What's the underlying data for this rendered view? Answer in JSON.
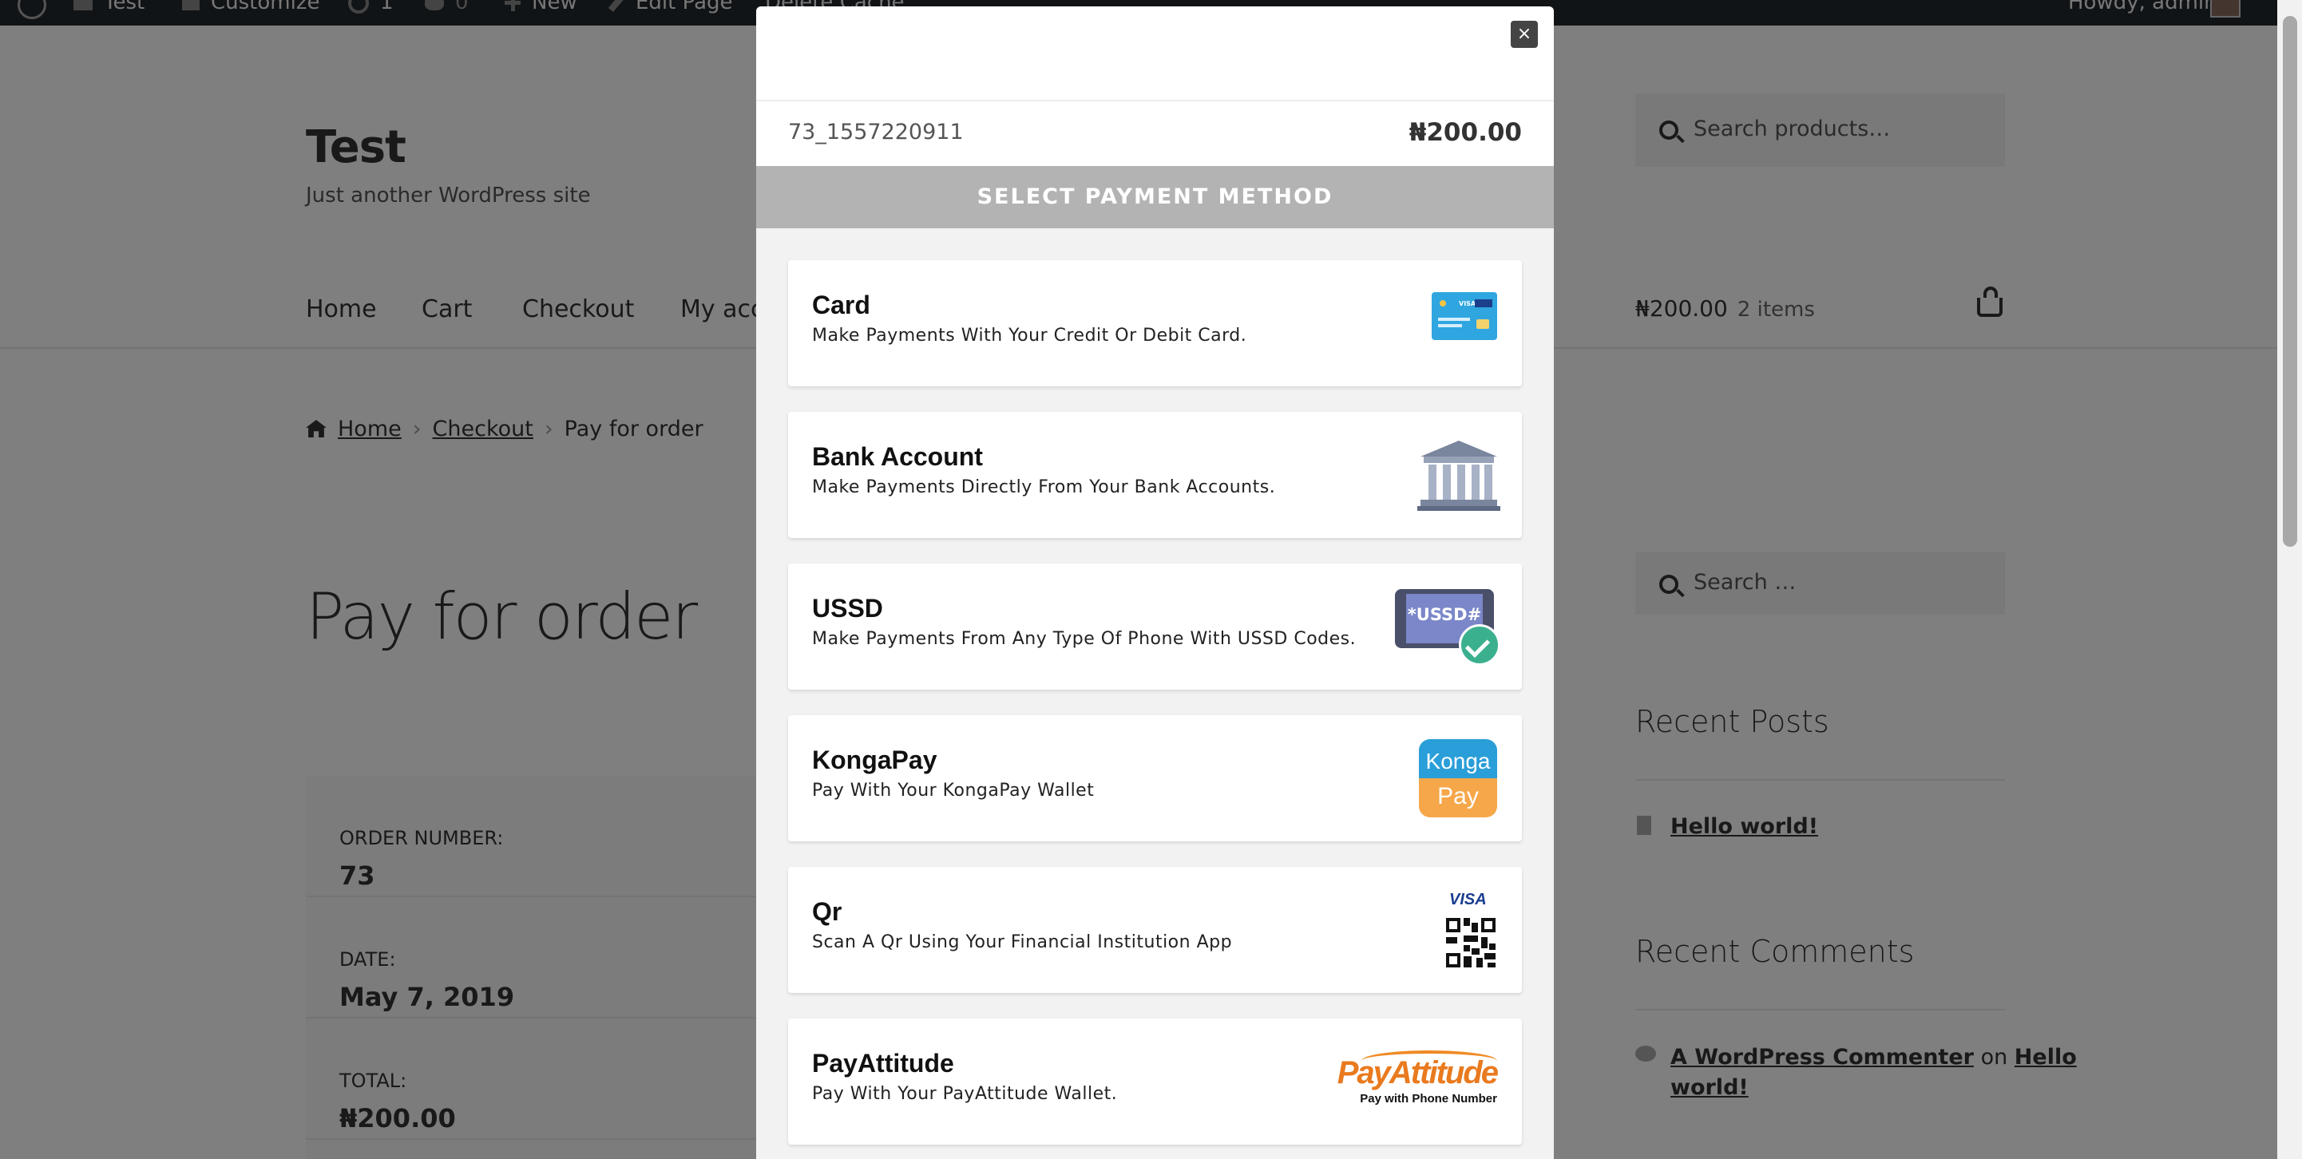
{
  "adminbar": {
    "site": "Test",
    "customize": "Customize",
    "updates": "1",
    "comments": "0",
    "new": "New",
    "edit_page": "Edit Page",
    "delete_cache": "Delete Cache",
    "howdy": "Howdy, admin"
  },
  "site": {
    "title": "Test",
    "description": "Just another WordPress site",
    "search_placeholder": "Search products…"
  },
  "nav": {
    "items": [
      "Home",
      "Cart",
      "Checkout",
      "My acco"
    ]
  },
  "cart": {
    "total": "₦200.00",
    "count": "2 items"
  },
  "breadcrumb": {
    "home": "Home",
    "checkout": "Checkout",
    "current": "Pay for order"
  },
  "page_title": "Pay for order",
  "order": {
    "rows": [
      {
        "label": "ORDER NUMBER:",
        "value": "73"
      },
      {
        "label": "DATE:",
        "value": "May 7, 2019"
      },
      {
        "label": "TOTAL:",
        "value": "₦200.00"
      }
    ]
  },
  "sidebar": {
    "search_placeholder": "Search …",
    "recent_posts_title": "Recent Posts",
    "post_link": "Hello world!",
    "recent_comments_title": "Recent Comments",
    "comment_author": "A WordPress Commenter",
    "comment_on": "on",
    "comment_post_1": "Hello",
    "comment_post_2": "world!"
  },
  "modal": {
    "close": "×",
    "reference": "73_1557220911",
    "amount": "₦200.00",
    "select_title": "SELECT PAYMENT METHOD",
    "methods": [
      {
        "title": "Card",
        "desc": "Make Payments With Your Credit Or Debit Card."
      },
      {
        "title": "Bank Account",
        "desc": "Make Payments Directly From Your Bank Accounts."
      },
      {
        "title": "USSD",
        "desc": "Make Payments From Any Type Of Phone With USSD Codes."
      },
      {
        "title": "KongaPay",
        "desc": "Pay With Your KongaPay Wallet"
      },
      {
        "title": "Qr",
        "desc": "Scan A Qr Using Your Financial Institution App"
      },
      {
        "title": "PayAttitude",
        "desc": "Pay With Your PayAttitude Wallet."
      }
    ],
    "logos": {
      "card_visa": "VISA",
      "ussd": "*USSD#",
      "konga_top": "Konga",
      "konga_bottom": "Pay",
      "qr_visa": "VISA",
      "payattitude_name": "PayAttitude",
      "payattitude_tagline": "Pay with Phone Number"
    }
  }
}
